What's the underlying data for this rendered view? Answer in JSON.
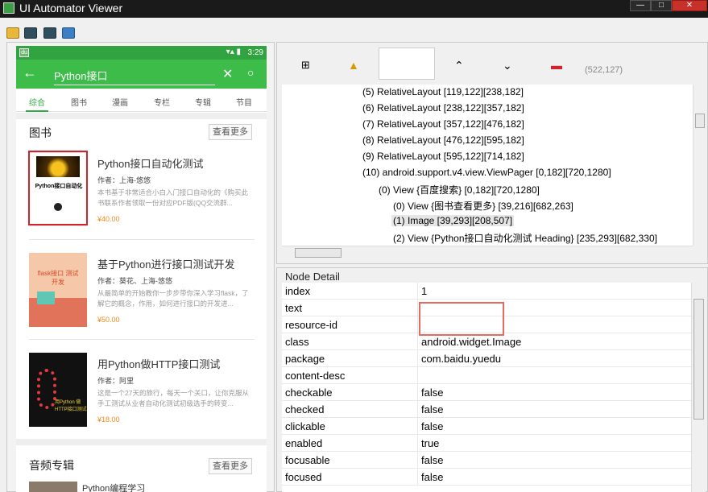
{
  "window": {
    "title": "UI Automator Viewer",
    "min": "—",
    "max": "□",
    "close": "✕"
  },
  "toolbar": {
    "icons": [
      "open-icon",
      "device-screenshot-icon",
      "device-screenshot-compressed-icon",
      "save-icon"
    ]
  },
  "phone": {
    "status": {
      "app": "du",
      "time": "3:29",
      "icons": "▾▴ ▮"
    },
    "search": {
      "query": "Python接口"
    },
    "tabs": [
      "综合",
      "图书",
      "漫画",
      "专栏",
      "专辑",
      "节目"
    ],
    "books_section": {
      "title": "图书",
      "more": "查看更多"
    },
    "books": [
      {
        "title": "Python接口自动化测试",
        "author": "作者：上海-悠悠",
        "desc": "本书基于非常适合小白入门接口自动化的《购买此书联系作者领取一份对应PDF版(QQ交流群...",
        "price": "¥40.00",
        "cover_title": "Python接口自动化"
      },
      {
        "title": "基于Python进行接口测试开发",
        "author": "作者：葵花、上海-悠悠",
        "desc": "从最简单的开始教你一步步带你深入学习flask，了解它的概念，作用，如何进行接口的开发进...",
        "price": "¥50.00",
        "cover_title": "flask接口 测试开发"
      },
      {
        "title": "用Python做HTTP接口测试",
        "author": "作者：阿里",
        "desc": "这是一个27天的旅行，每天一个关口，让你克服从手工测试从业者自动化测试初级选手的转变...",
        "price": "¥18.00",
        "cover_title": "用Python 做HTTP接口测试"
      }
    ],
    "audio_section": {
      "title": "音频专辑",
      "more": "查看更多",
      "first_item": "Python编程学习"
    }
  },
  "tree_toolbar": {
    "coords": "(522,127)"
  },
  "tree": [
    "(5) RelativeLayout [119,122][238,182]",
    "(6) RelativeLayout [238,122][357,182]",
    "(7) RelativeLayout [357,122][476,182]",
    "(8) RelativeLayout [476,122][595,182]",
    "(9) RelativeLayout [595,122][714,182]",
    "(10) android.support.v4.view.ViewPager [0,182][720,1280]",
    "(0) View {百度搜索} [0,182][720,1280]",
    "(0) View {图书查看更多} [39,216][682,263]",
    "(1) Image [39,293][208,507]",
    "(2) View {Python接口自动化测试 Heading} [235,293][682,330]"
  ],
  "detail": {
    "label": "Node Detail",
    "rows": [
      {
        "k": "index",
        "v": "1"
      },
      {
        "k": "text",
        "v": ""
      },
      {
        "k": "resource-id",
        "v": ""
      },
      {
        "k": "class",
        "v": "android.widget.Image"
      },
      {
        "k": "package",
        "v": "com.baidu.yuedu"
      },
      {
        "k": "content-desc",
        "v": ""
      },
      {
        "k": "checkable",
        "v": "false"
      },
      {
        "k": "checked",
        "v": "false"
      },
      {
        "k": "clickable",
        "v": "false"
      },
      {
        "k": "enabled",
        "v": "true"
      },
      {
        "k": "focusable",
        "v": "false"
      },
      {
        "k": "focused",
        "v": "false"
      }
    ]
  }
}
